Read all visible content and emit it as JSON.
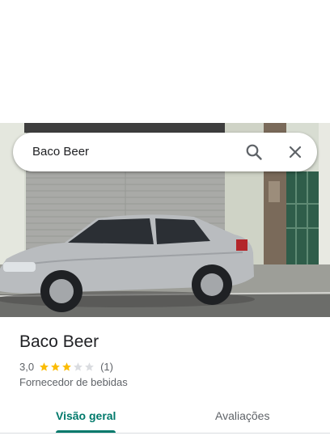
{
  "search": {
    "query": "Baco Beer"
  },
  "place": {
    "name": "Baco Beer",
    "rating_value": "3,0",
    "rating_stars": 3,
    "review_count": "(1)",
    "category": "Fornecedor de bebidas"
  },
  "tabs": [
    {
      "label": "Visão geral",
      "selected": true
    },
    {
      "label": "Avaliações",
      "selected": false
    }
  ],
  "colors": {
    "accent": "#00796b",
    "star": "#fbbc04",
    "star_empty": "#dadce0"
  },
  "icons": {
    "search": "search-icon",
    "close": "close-icon",
    "star": "star-icon"
  }
}
